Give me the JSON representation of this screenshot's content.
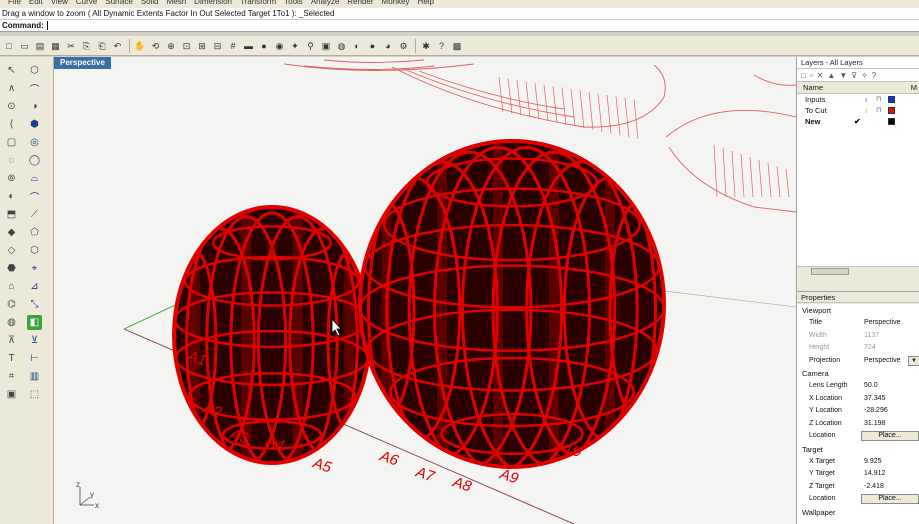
{
  "menubar": {
    "items": [
      "File",
      "Edit",
      "View",
      "Curve",
      "Surface",
      "Solid",
      "Mesh",
      "Dimension",
      "Transform",
      "Tools",
      "Analyze",
      "Render",
      "Monkey",
      "Help"
    ]
  },
  "prompt": {
    "text": "Drag a window to zoom ( All  Dynamic  Extents  Factor  In  Out  Selected  Target  1To1 ): _Selected"
  },
  "command": {
    "label": "Command:"
  },
  "toolbar": {
    "icons": [
      "new-file-icon",
      "open-folder-icon",
      "save-icon",
      "print-icon",
      "cut-icon",
      "copy-icon",
      "paste-icon",
      "undo-icon",
      "pan-hand-icon",
      "rotate-view-icon",
      "zoom-icon",
      "zoom-window-icon",
      "zoom-extents-icon",
      "zoom-selected-icon",
      "grid-icon",
      "car-icon",
      "shade-icon",
      "camera-icon",
      "light-icon",
      "bulb-icon",
      "layer-icon",
      "color-wheel-icon",
      "material-icon",
      "render-sphere-icon",
      "render-icon",
      "gear-icon",
      "options-icon",
      "help-icon",
      "osnap-icon"
    ],
    "glyphs": [
      "□",
      "▭",
      "▤",
      "▦",
      "✂",
      "⎘",
      "⎗",
      "↶",
      "✋",
      "⟲",
      "⊕",
      "⊡",
      "⊞",
      "⊟",
      "#",
      "▬",
      "●",
      "◉",
      "✦",
      "⚲",
      "▣",
      "◍",
      "◐",
      "●",
      "◕",
      "⚙",
      "✱",
      "?",
      "▩"
    ]
  },
  "lefttools": {
    "glyphs": [
      "↖",
      "⬡",
      "∧",
      "⌒",
      "⊙",
      "◑",
      "⟨",
      "⬢",
      "▢",
      "◎",
      "◌",
      "◯",
      "⊚",
      "⌓",
      "◐",
      "⌒",
      "⬒",
      "⟋",
      "◆",
      "⬠",
      "◇",
      "⬡",
      "⬣",
      "⌖",
      "⌂",
      "⊿",
      "⌬",
      "⤡",
      "◍",
      "◧",
      "⊼",
      "⊻",
      "T",
      "⊢",
      "⌗",
      "▥",
      "▣",
      "⬚"
    ]
  },
  "viewport": {
    "label": "Perspective",
    "slot_labels": [
      "A1",
      "A2",
      "A3",
      "A4",
      "A5",
      "A6",
      "A7",
      "A8",
      "A9",
      "A10"
    ],
    "colors": {
      "slice_red": "#e00000",
      "dark_fill": "#2a0000",
      "grid_line": "#8a5050",
      "green_axis": "#4aa84a",
      "red_axis": "#c04040"
    },
    "axis_labels": [
      "z",
      "x",
      "y"
    ]
  },
  "layers": {
    "title": "Layers - All Layers",
    "header_name": "Name",
    "header_m": "M",
    "rows": [
      {
        "name": "Inputs",
        "current": false,
        "color": "#1030e0"
      },
      {
        "name": "To Cut",
        "current": false,
        "color": "#e01010"
      },
      {
        "name": "New",
        "current": true,
        "color": "#000000"
      }
    ],
    "check": "✔"
  },
  "properties": {
    "title": "Properties",
    "viewport_section": "Viewport",
    "title_key": "Title",
    "title_value": "Perspective",
    "width_key": "Width",
    "width_value": "1137",
    "height_key": "Height",
    "height_value": "724",
    "projection_key": "Projection",
    "projection_value": "Perspective",
    "camera_section": "Camera",
    "lens_key": "Lens Length",
    "lens_value": "50.0",
    "xloc_key": "X Location",
    "xloc_value": "37.345",
    "yloc_key": "Y Location",
    "yloc_value": "-28.296",
    "zloc_key": "Z Location",
    "zloc_value": "31.198",
    "location_key": "Location",
    "place_label": "Place...",
    "target_section": "Target",
    "xt_key": "X Target",
    "xt_value": "9.925",
    "yt_key": "Y Target",
    "yt_value": "14.912",
    "zt_key": "Z Target",
    "zt_value": "-2.418",
    "location2_key": "Location",
    "place2_label": "Place...",
    "wallpaper_section": "Wallpaper"
  }
}
